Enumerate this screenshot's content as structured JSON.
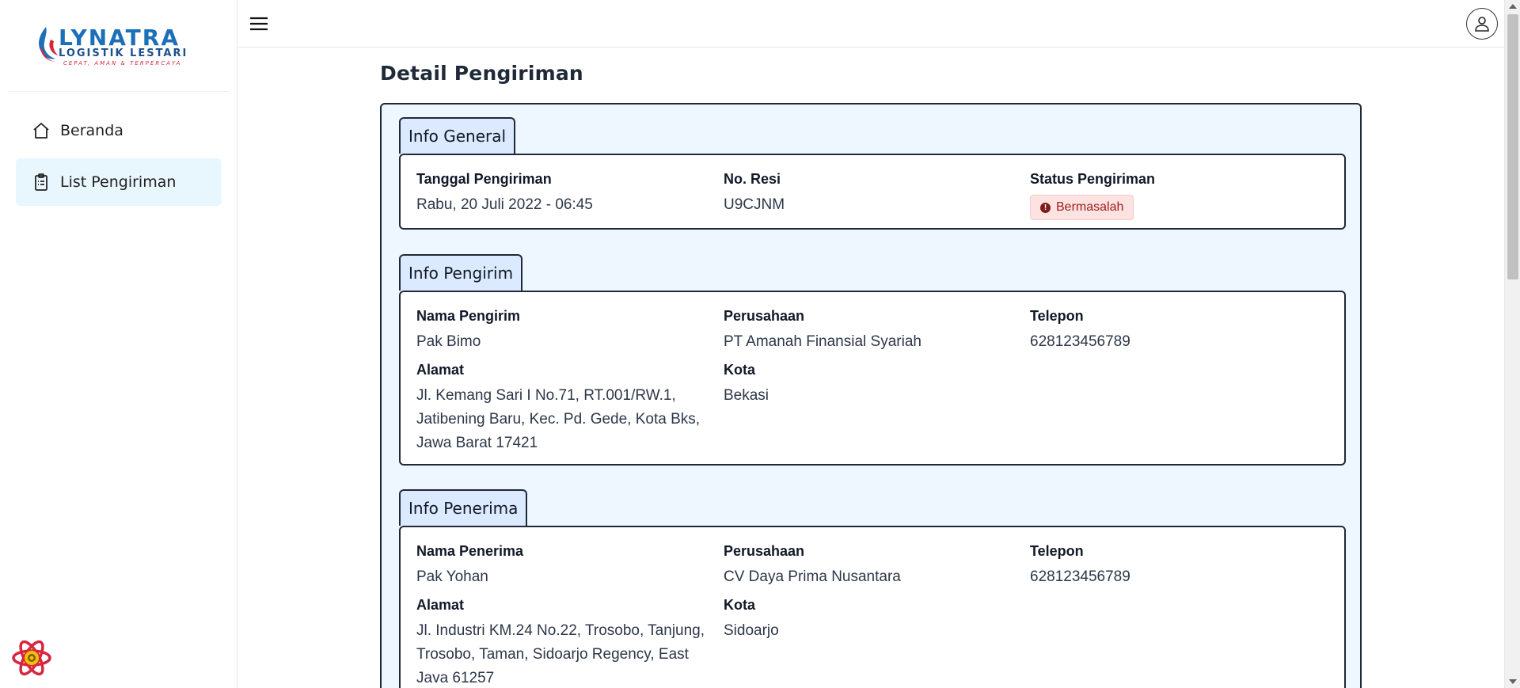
{
  "brand": {
    "name": "LYNATRA",
    "subtitle": "LOGISTIK LESTARI",
    "tagline": "CEPAT, AMAN & TERPERCAYA"
  },
  "sidebar": {
    "items": [
      {
        "label": "Beranda",
        "icon": "home-icon",
        "active": false
      },
      {
        "label": "List Pengiriman",
        "icon": "clipboard-icon",
        "active": true
      }
    ]
  },
  "page": {
    "title": "Detail Pengiriman"
  },
  "sections": {
    "general": {
      "tab": "Info General",
      "tanggal_label": "Tanggal Pengiriman",
      "tanggal_value": "Rabu, 20 Juli 2022 - 06:45",
      "resi_label": "No. Resi",
      "resi_value": "U9CJNM",
      "status_label": "Status Pengiriman",
      "status_value": "Bermasalah"
    },
    "pengirim": {
      "tab": "Info Pengirim",
      "nama_label": "Nama Pengirim",
      "nama_value": "Pak Bimo",
      "perusahaan_label": "Perusahaan",
      "perusahaan_value": "PT Amanah Finansial Syariah",
      "telepon_label": "Telepon",
      "telepon_value": "628123456789",
      "alamat_label": "Alamat",
      "alamat_value": "Jl. Kemang Sari I No.71, RT.001/RW.1, Jatibening Baru, Kec. Pd. Gede, Kota Bks, Jawa Barat 17421",
      "kota_label": "Kota",
      "kota_value": "Bekasi"
    },
    "penerima": {
      "tab": "Info Penerima",
      "nama_label": "Nama Penerima",
      "nama_value": "Pak Yohan",
      "perusahaan_label": "Perusahaan",
      "perusahaan_value": "CV Daya Prima Nusantara",
      "telepon_label": "Telepon",
      "telepon_value": "628123456789",
      "alamat_label": "Alamat",
      "alamat_value": "Jl. Industri KM.24 No.22, Trosobo, Tanjung, Trosobo, Taman, Sidoarjo Regency, East Java 61257",
      "kota_label": "Kota",
      "kota_value": "Sidoarjo"
    }
  },
  "colors": {
    "accent_blue": "#1d6fb8",
    "accent_red": "#d7263d",
    "status_bg": "#fde2e2",
    "card_bg": "#eef6ff"
  }
}
